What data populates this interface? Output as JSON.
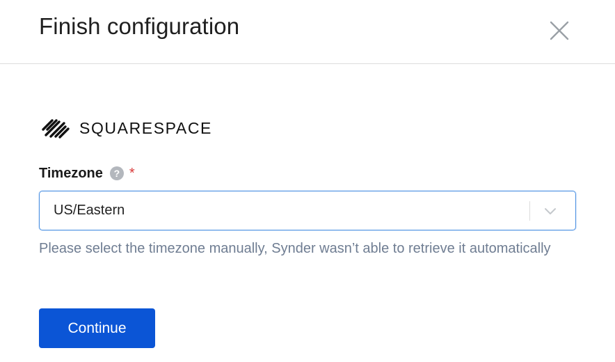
{
  "dialog": {
    "title": "Finish configuration",
    "close_icon": "close-icon"
  },
  "brand": {
    "name": "SQUARESPACE",
    "logo_icon": "squarespace-logo"
  },
  "timezone_field": {
    "label": "Timezone",
    "help_icon": "question-circle-icon",
    "help_glyph": "?",
    "required_marker": "*",
    "selected_value": "US/Eastern",
    "dropdown_icon": "chevron-down-icon",
    "hint": "Please select the timezone manually, Synder wasn’t able to retrieve it automatically"
  },
  "actions": {
    "continue_label": "Continue"
  },
  "colors": {
    "primary_button": "#0b55d6",
    "focus_border": "#4a90e2",
    "hint_text": "#6f7d92",
    "required": "#d93a3a",
    "divider": "#dcdcdc"
  }
}
